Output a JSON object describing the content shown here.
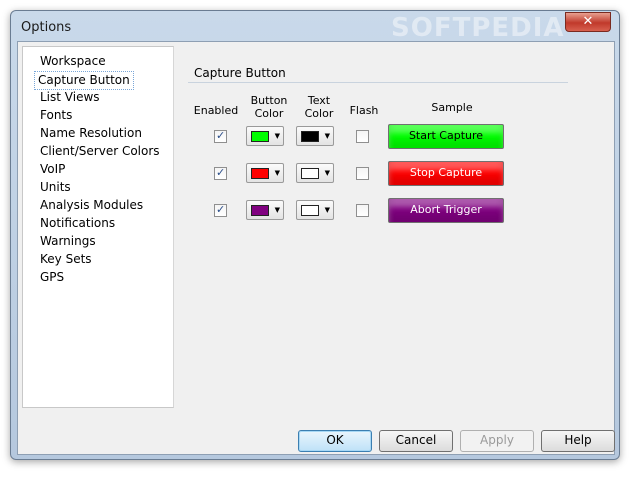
{
  "window": {
    "title": "Options",
    "close_glyph": "✕",
    "watermark": "SOFTPEDIA"
  },
  "nav": {
    "items": [
      "Workspace",
      "Capture Button",
      "List Views",
      "Fonts",
      "Name Resolution",
      "Client/Server Colors",
      "VoIP",
      "Units",
      "Analysis Modules",
      "Notifications",
      "Warnings",
      "Key Sets",
      "GPS"
    ],
    "selected": "Capture Button"
  },
  "panel": {
    "title": "Capture Button",
    "columns": {
      "enabled": "Enabled",
      "button_color": "Button Color",
      "text_color": "Text Color",
      "flash": "Flash",
      "sample": "Sample"
    },
    "rows": [
      {
        "enabled": true,
        "flash": false,
        "button_color": "#00ff00",
        "text_color": "#000000",
        "sample_label": "Start Capture",
        "sample_text_color": "#000000"
      },
      {
        "enabled": true,
        "flash": false,
        "button_color": "#ff0000",
        "text_color": "#ffffff",
        "sample_label": "Stop Capture",
        "sample_text_color": "#ffffff"
      },
      {
        "enabled": true,
        "flash": false,
        "button_color": "#800080",
        "text_color": "#ffffff",
        "sample_label": "Abort Trigger",
        "sample_text_color": "#ffffff"
      }
    ]
  },
  "buttons": {
    "ok": "OK",
    "cancel": "Cancel",
    "apply": "Apply",
    "help": "Help"
  }
}
